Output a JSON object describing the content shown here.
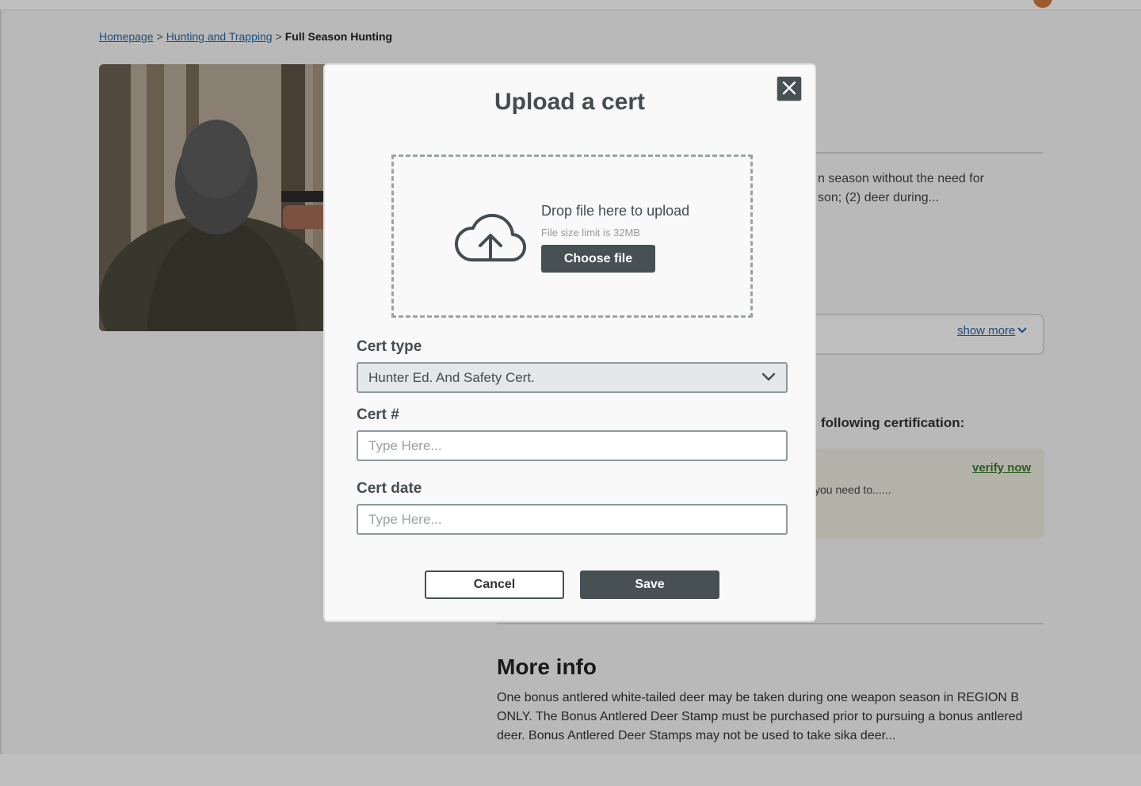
{
  "breadcrumb": {
    "items": [
      "Homepage",
      "Hunting and Trapping"
    ],
    "separator": ">",
    "current": "Full Season Hunting"
  },
  "background": {
    "description_lines": [
      "n season without the need for",
      "son; (2) deer during..."
    ],
    "show_more": "show more",
    "certification_heading": "following certification:",
    "verify_link": "verify now",
    "need_to_text": "you need to......",
    "more_info_title": "More info",
    "more_info_body": "One bonus antlered white-tailed deer may be taken during one weapon season in REGION B ONLY. The Bonus Antlered Deer Stamp must be purchased prior to pursuing a bonus antlered deer. Bonus Antlered Deer Stamps may not be used to take sika deer..."
  },
  "modal": {
    "title": "Upload a cert",
    "close_icon": "close-icon",
    "dropzone": {
      "icon": "cloud-upload-icon",
      "drop_text": "Drop file here to upload",
      "limit_text": "File size limit is 32MB",
      "choose_label": "Choose file"
    },
    "cert_type": {
      "label": "Cert type",
      "selected": "Hunter Ed. And Safety Cert."
    },
    "cert_number": {
      "label": "Cert #",
      "placeholder": "Type Here...",
      "value": ""
    },
    "cert_date": {
      "label": "Cert date",
      "placeholder": "Type Here...",
      "value": ""
    },
    "cancel_label": "Cancel",
    "save_label": "Save"
  },
  "colors": {
    "primary_dark": "#475154",
    "link_blue": "#2b6aa8",
    "verify_green": "#3c7a2e",
    "overlay": "rgba(0,0,0,0.25)"
  }
}
